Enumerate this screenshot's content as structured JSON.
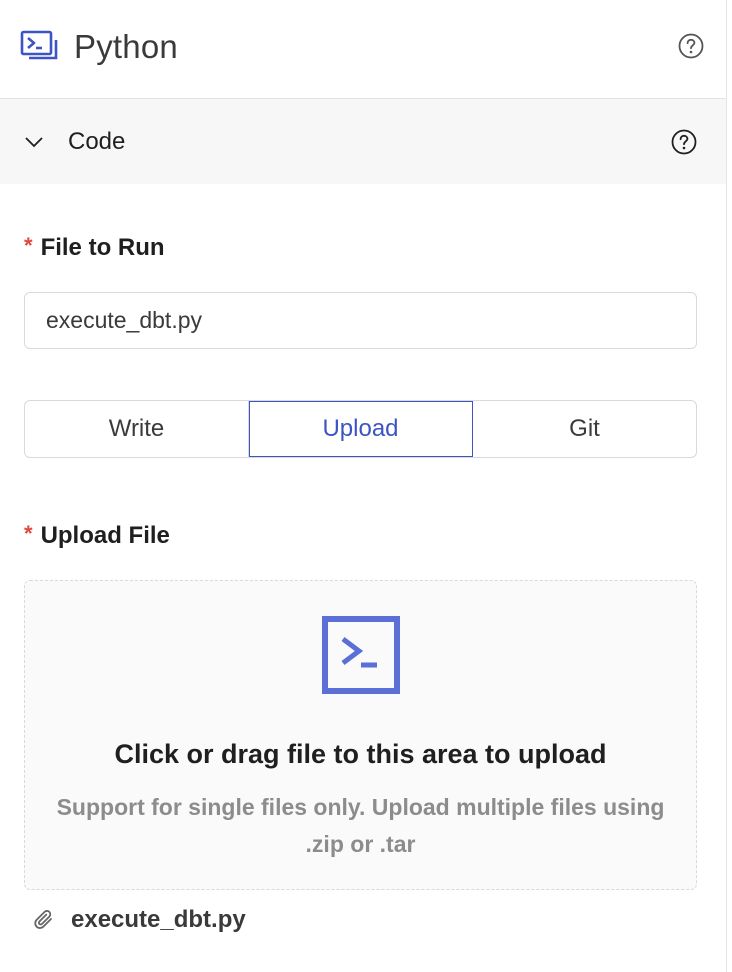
{
  "header": {
    "title": "Python",
    "logo_icon": "python-terminal-icon",
    "help_icon": "question-circle-icon"
  },
  "section": {
    "label": "Code",
    "expanded": true,
    "chevron_icon": "chevron-down-icon",
    "help_icon": "question-circle-icon"
  },
  "fields": {
    "file_to_run": {
      "required_mark": "*",
      "label": "File to Run",
      "value": "execute_dbt.py"
    },
    "upload_file": {
      "required_mark": "*",
      "label": "Upload File"
    }
  },
  "source_tabs": {
    "options": [
      "Write",
      "Upload",
      "Git"
    ],
    "selected": "Upload"
  },
  "dropzone": {
    "icon": "terminal-icon",
    "title": "Click or drag file to this area to upload",
    "hint_line1": "Support for single files only. Upload multiple files using",
    "hint_line2": ".zip or .tar"
  },
  "uploaded_file": {
    "icon": "paperclip-icon",
    "name": "execute_dbt.py"
  },
  "colors": {
    "accent": "#3d55c4",
    "required": "#e0483c",
    "icon_blue": "#5b6fd6"
  }
}
